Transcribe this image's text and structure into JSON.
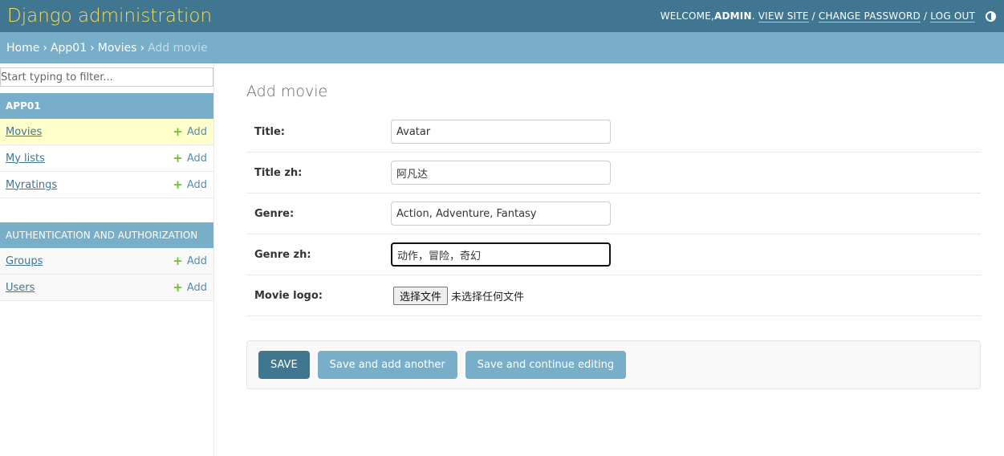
{
  "header": {
    "brand": "Django administration",
    "welcome": "WELCOME, ",
    "username": "ADMIN",
    "view_site": "VIEW SITE",
    "change_password": "CHANGE PASSWORD",
    "log_out": "LOG OUT",
    "separator": "/"
  },
  "breadcrumbs": {
    "home": "Home",
    "app": "App01",
    "model": "Movies",
    "current": "Add movie",
    "arrow": "›"
  },
  "sidebar": {
    "filter_placeholder": "Start typing to filter...",
    "add_label": "Add",
    "modules": [
      {
        "caption": "APP01",
        "models": [
          {
            "name": "Movies",
            "active": true
          },
          {
            "name": "My lists"
          },
          {
            "name": "Myratings"
          }
        ]
      },
      {
        "caption": "AUTHENTICATION AND AUTHORIZATION",
        "models": [
          {
            "name": "Groups"
          },
          {
            "name": "Users"
          }
        ]
      }
    ]
  },
  "form": {
    "title": "Add movie",
    "fields": [
      {
        "label": "Title:",
        "value": "Avatar"
      },
      {
        "label": "Title zh:",
        "value": "阿凡达"
      },
      {
        "label": "Genre:",
        "value": "Action, Adventure, Fantasy"
      },
      {
        "label": "Genre zh:",
        "value": "动作，冒险，奇幻"
      },
      {
        "label": "Movie logo:",
        "file_button": "选择文件",
        "file_status": "未选择任何文件"
      }
    ],
    "buttons": {
      "save": "SAVE",
      "save_add_another": "Save and add another",
      "save_continue": "Save and continue editing"
    }
  },
  "colors": {
    "header_bg": "#417690",
    "brand": "#f5dd5d",
    "breadcrumb_bg": "#79aec8",
    "active_row": "#ffffcc",
    "add_icon": "#70bf2b"
  }
}
